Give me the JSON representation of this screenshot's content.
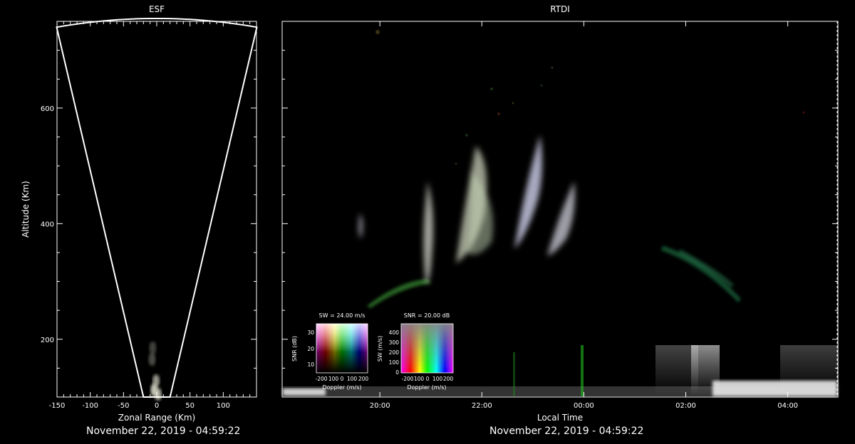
{
  "colors": {
    "background": "#000000",
    "axis": "#ffffff"
  },
  "chart_data": [
    {
      "type": "scatter",
      "title": "ESF",
      "xlabel": "Zonal Range (Km)",
      "ylabel": "Altitude (Km)",
      "xlim": [
        -150,
        150
      ],
      "ylim": [
        100,
        750
      ],
      "xticks": [
        -150,
        -100,
        -50,
        0,
        50,
        100
      ],
      "yticks": [
        200,
        400,
        600
      ],
      "beam_half_angle_deg": 11.5,
      "beam_max_range_km": 755,
      "echo_points": [
        {
          "x": -4,
          "y": 112,
          "intensity": 0.9
        },
        {
          "x": -1,
          "y": 128,
          "intensity": 0.7
        },
        {
          "x": -7,
          "y": 165,
          "intensity": 0.35
        },
        {
          "x": -6,
          "y": 185,
          "intensity": 0.3
        },
        {
          "x": 2,
          "y": 105,
          "intensity": 0.8
        }
      ],
      "footer": "November 22, 2019 - 04:59:22"
    },
    {
      "type": "heatmap",
      "title": "RTDI",
      "xlabel": "Local Time",
      "ylabel": "",
      "xlim": [
        "2019-11-21 18:05",
        "2019-11-22 04:59"
      ],
      "ylim": [
        100,
        750
      ],
      "xticks": [
        "20:00",
        "22:00",
        "00:00",
        "02:00",
        "04:00"
      ],
      "yticks": [
        200,
        400,
        600
      ],
      "echo_regions": [
        {
          "time": "2019-11-21 20:52",
          "alt": 360,
          "snr": 0.8,
          "doppler": "white"
        },
        {
          "time": "2019-11-21 21:05",
          "alt": 430,
          "snr": 0.7,
          "doppler": "white"
        },
        {
          "time": "2019-11-21 21:50",
          "alt": 420,
          "snr": 0.75,
          "doppler": "white"
        },
        {
          "time": "2019-11-21 22:30",
          "alt": 400,
          "snr": 0.7,
          "doppler": "white"
        },
        {
          "time": "2019-11-21 23:00",
          "alt": 360,
          "snr": 0.6,
          "doppler": "white"
        },
        {
          "time": "2019-11-21 20:15",
          "alt": 270,
          "snr": 0.5,
          "doppler": "green"
        },
        {
          "time": "2019-11-22 01:40",
          "alt": 340,
          "snr": 0.4,
          "doppler": "green"
        },
        {
          "time": "2019-11-22 02:30",
          "alt": 320,
          "snr": 0.4,
          "doppler": "green"
        },
        {
          "time": "2019-11-21 19:50",
          "alt": 390,
          "snr": 0.45,
          "doppler": "white"
        }
      ],
      "legends": [
        {
          "title": "SW = 24.00 m/s",
          "xlabel": "Doppler (m/s)",
          "ylabel": "SNR (dB)",
          "xticks": [
            "-200",
            "100",
            "0",
            "100",
            "200"
          ],
          "yticks": [
            "10",
            "20",
            "30"
          ]
        },
        {
          "title": "SNR = 20.00 dB",
          "xlabel": "Doppler (m/s)",
          "ylabel": "SW (m/s)",
          "xticks": [
            "-200",
            "100",
            "0",
            "100",
            "200"
          ],
          "yticks": [
            "0",
            "100",
            "200",
            "300",
            "400"
          ]
        }
      ],
      "footer": "November 22, 2019 - 04:59:22"
    }
  ]
}
